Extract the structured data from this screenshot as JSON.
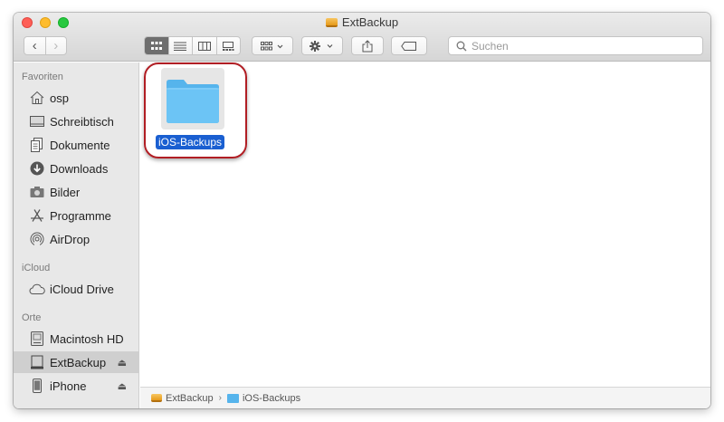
{
  "window": {
    "title": "ExtBackup"
  },
  "toolbar": {
    "nav_back": "‹",
    "nav_forward": "›",
    "search_placeholder": "Suchen"
  },
  "sidebar": {
    "sections": [
      {
        "heading": "Favoriten",
        "items": [
          {
            "label": "osp",
            "icon": "home-icon"
          },
          {
            "label": "Schreibtisch",
            "icon": "desktop-icon"
          },
          {
            "label": "Dokumente",
            "icon": "documents-icon"
          },
          {
            "label": "Downloads",
            "icon": "downloads-icon"
          },
          {
            "label": "Bilder",
            "icon": "camera-icon"
          },
          {
            "label": "Programme",
            "icon": "applications-icon"
          },
          {
            "label": "AirDrop",
            "icon": "airdrop-icon"
          }
        ]
      },
      {
        "heading": "iCloud",
        "items": [
          {
            "label": "iCloud Drive",
            "icon": "cloud-icon"
          }
        ]
      },
      {
        "heading": "Orte",
        "items": [
          {
            "label": "Macintosh HD",
            "icon": "hard-drive-icon"
          },
          {
            "label": "ExtBackup",
            "icon": "external-drive-icon",
            "selected": true,
            "eject": "⏏"
          },
          {
            "label": "iPhone",
            "icon": "iphone-icon",
            "eject": "⏏"
          }
        ]
      }
    ]
  },
  "content": {
    "items": [
      {
        "name": "iOS-Backups",
        "icon": "folder-icon",
        "selected": true
      }
    ]
  },
  "pathbar": {
    "items": [
      "ExtBackup",
      "iOS-Backups"
    ],
    "separator": "›"
  },
  "colors": {
    "accent": "#1a5fd1",
    "highlight_ring": "#b11e24",
    "folder": "#56b4ec"
  }
}
